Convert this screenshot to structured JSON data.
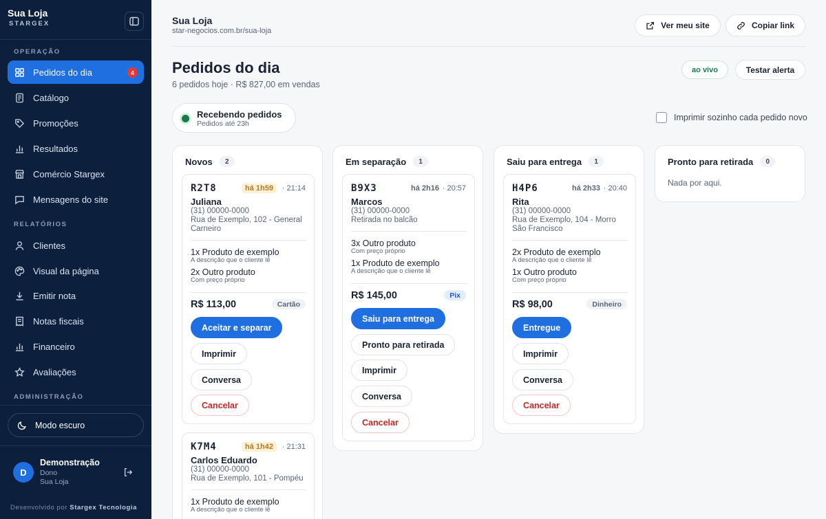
{
  "sidebar": {
    "brand_name": "Sua Loja",
    "brand_sub": "STARGEX",
    "sections": [
      "OPERAÇÃO",
      "RELATÓRIOS",
      "ADMINISTRAÇÃO"
    ],
    "items": [
      {
        "label": "Pedidos do dia",
        "icon": "grid-icon",
        "badge": "4",
        "active": true
      },
      {
        "label": "Catálogo",
        "icon": "document-icon"
      },
      {
        "label": "Promoções",
        "icon": "tag-icon"
      },
      {
        "label": "Resultados",
        "icon": "bar-chart-icon"
      },
      {
        "label": "Comércio Stargex",
        "icon": "storefront-icon"
      },
      {
        "label": "Mensagens do site",
        "icon": "message-icon"
      },
      {
        "label": "Clientes",
        "icon": "user-icon"
      },
      {
        "label": "Visual da página",
        "icon": "palette-icon"
      },
      {
        "label": "Emitir nota",
        "icon": "download-icon"
      },
      {
        "label": "Notas fiscais",
        "icon": "receipt-icon"
      },
      {
        "label": "Financeiro",
        "icon": "bar-chart-icon"
      },
      {
        "label": "Avaliações",
        "icon": "star-icon"
      }
    ],
    "dark_mode_label": "Modo escuro",
    "user": {
      "initial": "D",
      "name": "Demonstração",
      "role": "Dono",
      "store": "Sua Loja"
    },
    "footer_prefix": "Desenvolvido por",
    "footer_company": "Stargex Tecnologia"
  },
  "header": {
    "store_name": "Sua Loja",
    "store_url": "star-negocios.com.br/sua-loja",
    "view_site": "Ver meu site",
    "copy_link": "Copiar link"
  },
  "page": {
    "title": "Pedidos do dia",
    "subtitle": "6 pedidos hoje · R$ 827,00 em vendas",
    "live": "ao vivo",
    "test_alert": "Testar alerta",
    "receiving_title": "Recebendo pedidos",
    "receiving_sub": "Pedidos até 23h",
    "autoprint": "Imprimir sozinho cada pedido novo"
  },
  "columns": [
    {
      "title": "Novos",
      "count": "2"
    },
    {
      "title": "Em separação",
      "count": "1"
    },
    {
      "title": "Saiu para entrega",
      "count": "1"
    },
    {
      "title": "Pronto para retirada",
      "count": "0",
      "empty": "Nada por aqui."
    }
  ],
  "orders": [
    {
      "code": "R2T8",
      "age": "há 1h59",
      "time": "· 21:14",
      "customer": "Juliana",
      "phone": "(31) 00000-0000",
      "address": "Rua de Exemplo, 102 - General Carneiro",
      "items": [
        {
          "qty": "1x Produto de exemplo",
          "desc": "A descrição que o cliente lê"
        },
        {
          "qty": "2x Outro produto",
          "desc": "Com preço próprio"
        }
      ],
      "total": "R$ 113,00",
      "payment": "Cartão",
      "actions": [
        "Aceitar e separar",
        "Imprimir",
        "Conversa",
        "Cancelar"
      ]
    },
    {
      "code": "K7M4",
      "age": "há 1h42",
      "time": "· 21:31",
      "customer": "Carlos Eduardo",
      "phone": "(31) 00000-0000",
      "address": "Rua de Exemplo, 101 - Pompéu",
      "items": [
        {
          "qty": "1x Produto de exemplo",
          "desc": "A descrição que o cliente lê"
        }
      ]
    },
    {
      "code": "B9X3",
      "age": "há 2h16",
      "time": "· 20:57",
      "customer": "Marcos",
      "phone": "(31) 00000-0000",
      "address": "Retirada no balcão",
      "items": [
        {
          "qty": "3x Outro produto",
          "desc": "Com preço próprio"
        },
        {
          "qty": "1x Produto de exemplo",
          "desc": "A descrição que o cliente lê"
        }
      ],
      "total": "R$ 145,00",
      "payment": "Pix",
      "actions": [
        "Saiu para entrega",
        "Pronto para retirada",
        "Imprimir",
        "Conversa",
        "Cancelar"
      ]
    },
    {
      "code": "H4P6",
      "age": "há 2h33",
      "time": "· 20:40",
      "customer": "Rita",
      "phone": "(31) 00000-0000",
      "address": "Rua de Exemplo, 104 - Morro São Francisco",
      "items": [
        {
          "qty": "2x Produto de exemplo",
          "desc": "A descrição que o cliente lê"
        },
        {
          "qty": "1x Outro produto",
          "desc": "Com preço próprio"
        }
      ],
      "total": "R$ 98,00",
      "payment": "Dinheiro",
      "actions": [
        "Entregue",
        "Imprimir",
        "Conversa",
        "Cancelar"
      ]
    }
  ],
  "colors": {
    "sidebar_bg": "#0c1f3d",
    "accent": "#1f6fe0",
    "live": "#18794e",
    "danger": "#c62828",
    "badge": "#e53935"
  }
}
